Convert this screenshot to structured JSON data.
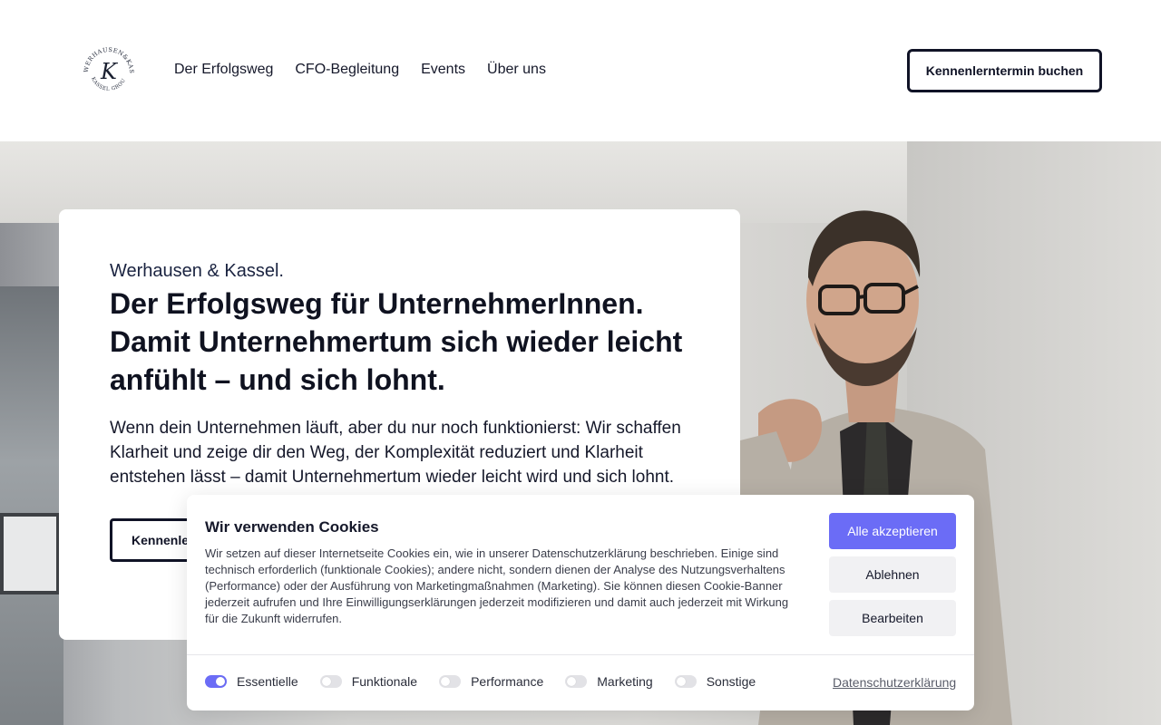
{
  "header": {
    "logo_text": "WERHAUSEN&KASSEL KASSEL GROUP",
    "logo_letter": "K",
    "nav": [
      {
        "label": "Der Erfolgsweg"
      },
      {
        "label": "CFO-Begleitung"
      },
      {
        "label": "Events"
      },
      {
        "label": "Über uns"
      }
    ],
    "cta_label": "Kennenlerntermin buchen"
  },
  "hero": {
    "brand": "Werhausen & Kassel.",
    "headline": "Der Erfolgsweg für UnternehmerInnen. Damit Unternehmertum sich wieder leicht anfühlt – und sich lohnt.",
    "lead": "Wenn dein Unternehmen läuft, aber du nur noch funktionierst: Wir schaffen Klarheit  und zeige dir den Weg, der Komplexität reduziert und Klarheit entstehen lässt – damit Unternehmertum wieder leicht wird und sich lohnt.",
    "cta_label": "Kennenlerntermin buchen"
  },
  "cookie": {
    "title": "Wir verwenden Cookies",
    "text": "Wir setzen auf dieser Internetseite Cookies ein, wie in unserer Datenschutzerklärung beschrieben. Einige sind technisch erforderlich (funktionale Cookies); andere nicht, sondern dienen der Analyse des Nutzungsverhaltens (Performance) oder der Ausführung von Marketingmaßnahmen (Marketing). Sie können diesen Cookie-Banner jederzeit aufrufen und Ihre Einwilligungserklärungen jederzeit modifizieren und damit auch jederzeit mit Wirkung für die Zukunft widerrufen.",
    "accept_label": "Alle akzeptieren",
    "decline_label": "Ablehnen",
    "edit_label": "Bearbeiten",
    "categories": [
      {
        "label": "Essentielle",
        "enabled": true
      },
      {
        "label": "Funktionale",
        "enabled": false
      },
      {
        "label": "Performance",
        "enabled": false
      },
      {
        "label": "Marketing",
        "enabled": false
      },
      {
        "label": "Sonstige",
        "enabled": false
      }
    ],
    "privacy_link": "Datenschutzerklärung"
  },
  "colors": {
    "accent": "#6b6cf6",
    "dark": "#101326"
  }
}
